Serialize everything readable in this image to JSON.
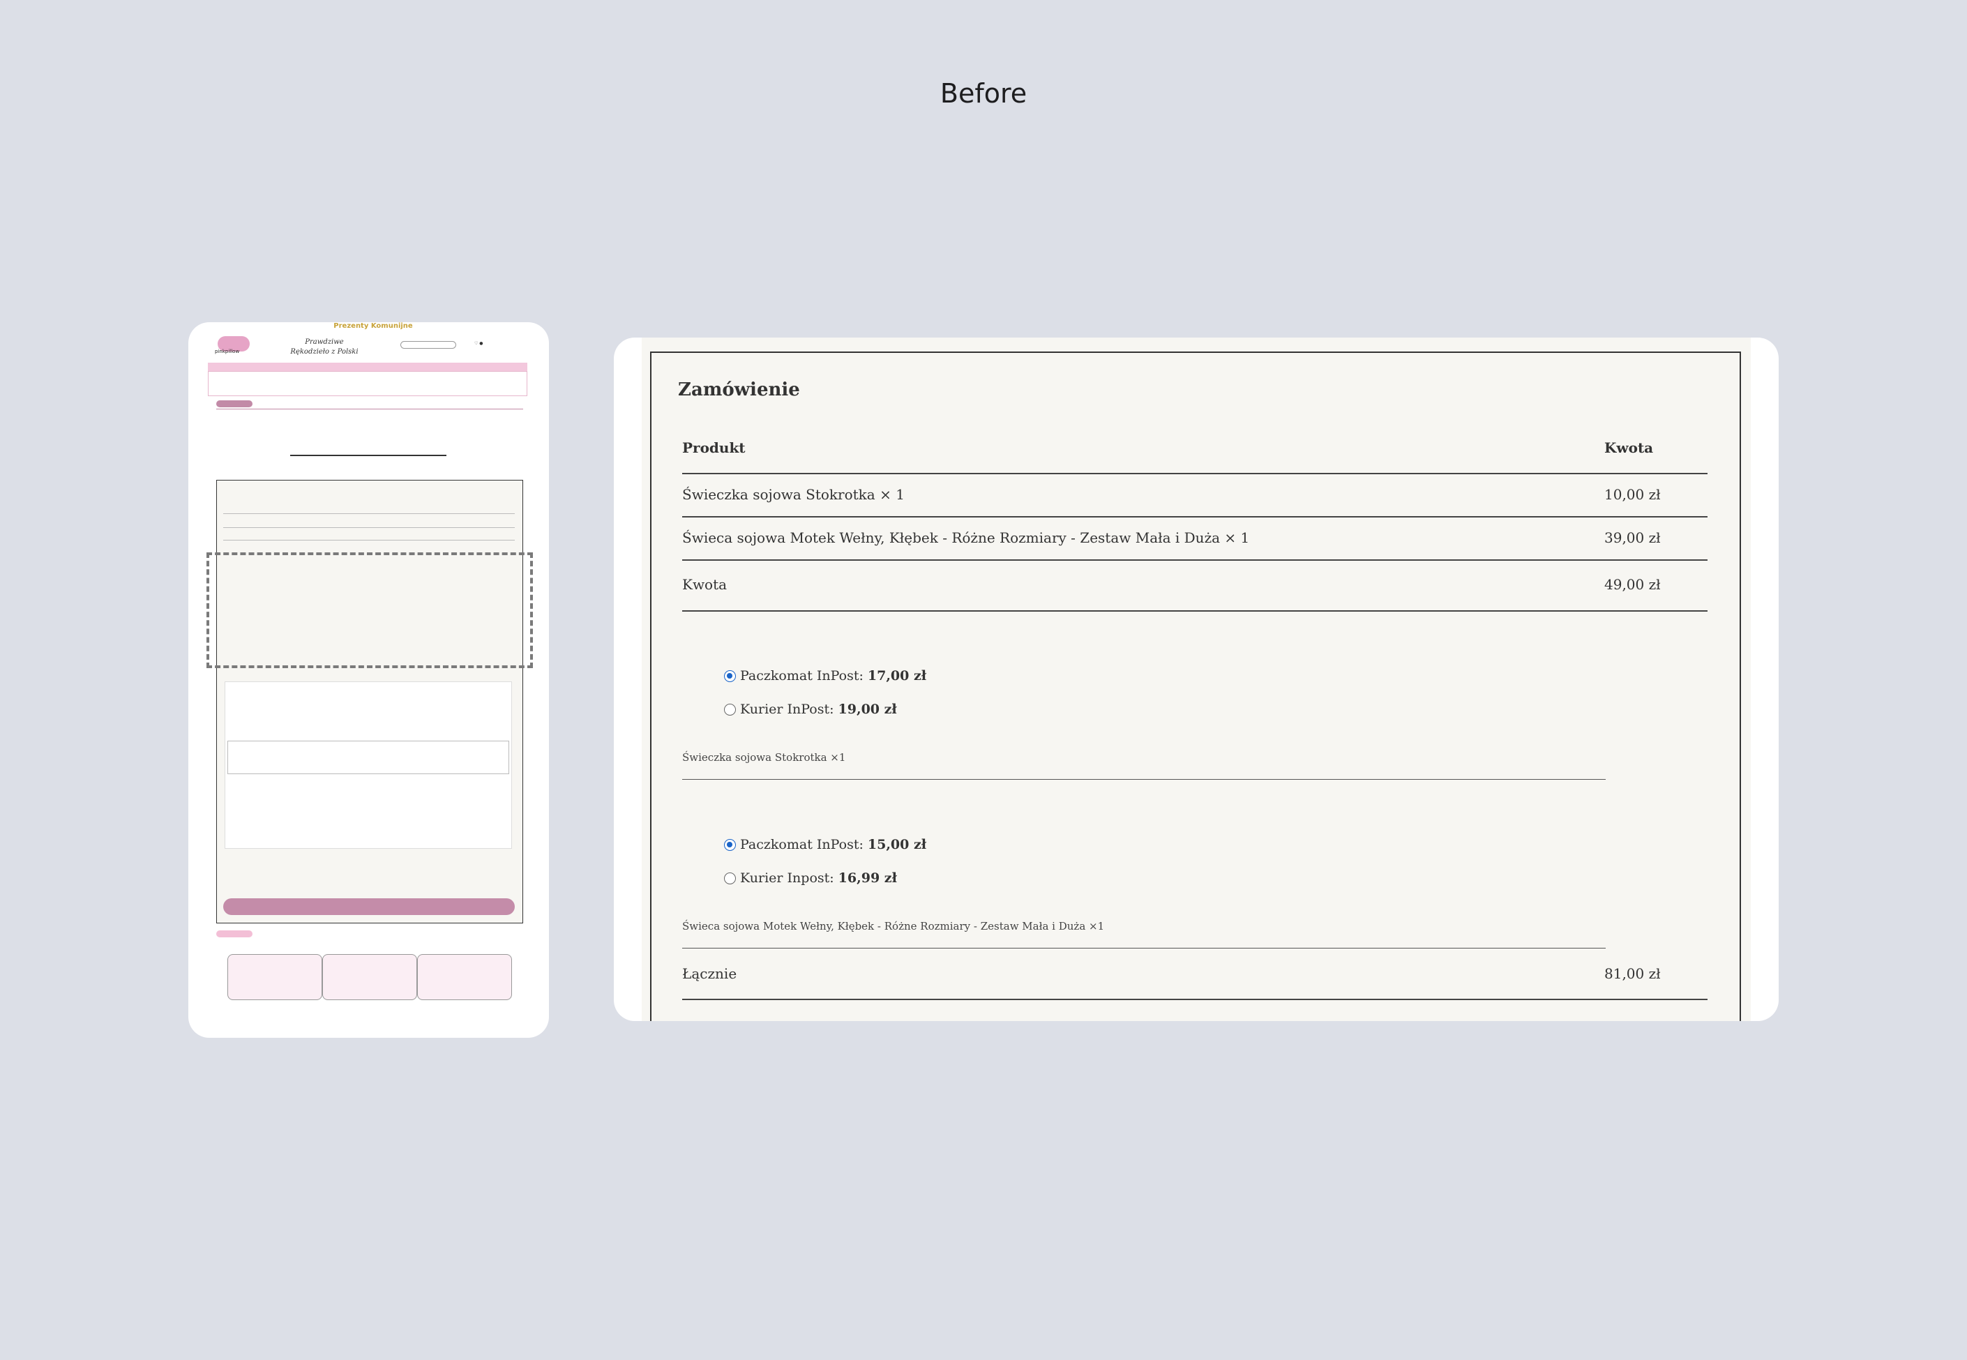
{
  "heading": "Before",
  "thumbnail": {
    "promo": "Prezenty Komunijne",
    "logo": "pinkpillow",
    "tagline": "Prawdziwe Rękodzieło z Polski"
  },
  "order": {
    "title": "Zamówienie",
    "col_product": "Produkt",
    "col_amount": "Kwota",
    "items": [
      {
        "name": "Świeczka sojowa Stokrotka",
        "qty": "× 1",
        "amount": "10,00 zł"
      },
      {
        "name": "Świeca sojowa Motek Wełny, Kłębek - Różne Rozmiary - Zestaw Mała i Duża",
        "qty": "× 1",
        "amount": "39,00 zł"
      }
    ],
    "subtotal_label": "Kwota",
    "subtotal_amount": "49,00 zł",
    "shipping_groups": [
      {
        "options": [
          {
            "label": "Paczkomat InPost:",
            "price": "17,00 zł",
            "selected": true
          },
          {
            "label": "Kurier InPost:",
            "price": "19,00 zł",
            "selected": false
          }
        ],
        "item_label": "Świeczka sojowa Stokrotka ×1"
      },
      {
        "options": [
          {
            "label": "Paczkomat InPost:",
            "price": "15,00 zł",
            "selected": true
          },
          {
            "label": "Kurier Inpost:",
            "price": "16,99 zł",
            "selected": false
          }
        ],
        "item_label": "Świeca sojowa Motek Wełny, Kłębek - Różne Rozmiary - Zestaw Mała i Duża ×1"
      }
    ],
    "total_label": "Łącznie",
    "total_amount": "81,00 zł"
  },
  "colors": {
    "background": "#dcdfe7",
    "sheet": "#f7f6f2",
    "accent_pink": "#c48ca9",
    "radio_blue": "#1a64c8"
  }
}
